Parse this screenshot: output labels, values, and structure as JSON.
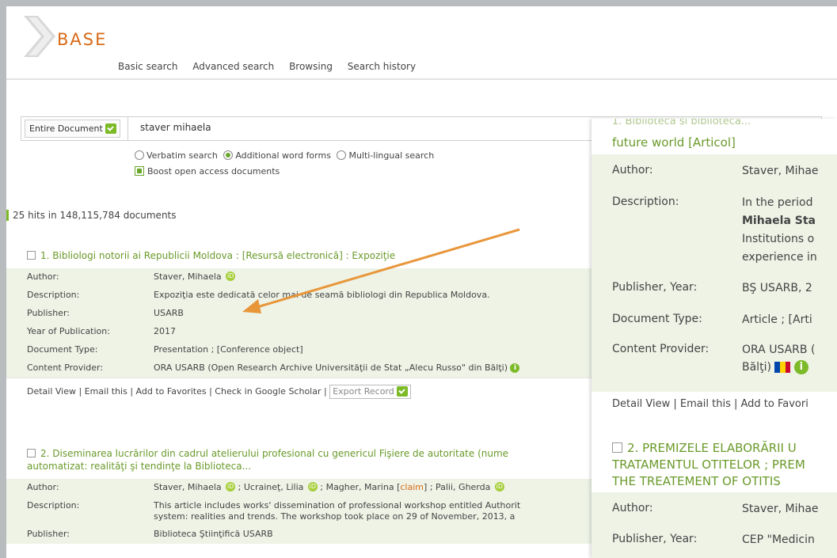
{
  "brand": {
    "logo_text": "BASE",
    "accent": "#d86a18",
    "green": "#7cba28"
  },
  "nav": {
    "items": [
      "Basic search",
      "Advanced search",
      "Browsing",
      "Search history"
    ]
  },
  "search": {
    "scope": "Entire Document",
    "query": "staver mihaela",
    "options": [
      {
        "label": "Verbatim search",
        "selected": false
      },
      {
        "label": "Additional word forms",
        "selected": true
      },
      {
        "label": "Multi-lingual search",
        "selected": false
      }
    ],
    "boost_label": "Boost open access documents",
    "boost_checked": true
  },
  "hits_text": "25 hits in 148,115,784 documents",
  "labels": {
    "author": "Author:",
    "description": "Description:",
    "publisher": "Publisher:",
    "year": "Year of Publication:",
    "doctype": "Document Type:",
    "provider": "Content Provider:"
  },
  "results": [
    {
      "title": "1. Bibliologi notorii ai Republicii Moldova : [Resursă electronică] : Expoziţie",
      "author": "Staver, Mihaela",
      "description": "Expoziţia este dedicată celor mai de seamă bibliologi din Republica Moldova.",
      "publisher": "USARB",
      "year": "2017",
      "doctype": "Presentation ; [Conference object]",
      "provider": "ORA USARB (Open Research Archive Universităţii de Stat „Alecu Russo\" din Bălţi)"
    },
    {
      "title_line1": "2. Diseminarea lucrărilor din cadrul atelierului profesional cu genericul Fişiere de autoritate (nume",
      "title_line2": "automatizat: realităţi şi tendinţe la Biblioteca...",
      "authors": [
        {
          "name": "Staver, Mihaela",
          "orcid": true
        },
        {
          "name": "Ucraineţ, Lilia",
          "orcid": true
        },
        {
          "name": "Magher, Marina",
          "claim": "claim"
        },
        {
          "name": "Palii, Gherda",
          "orcid": true
        }
      ],
      "description_line1": "This article includes works' dissemination of professional workshop entitled Authorit",
      "description_line2": "system: realities and trends. The workshop took place on 29 of November, 2013, a",
      "publisher": "Biblioteca Ştiinţifică USARB"
    }
  ],
  "actions": {
    "detail": "Detail View",
    "email": "Email this",
    "favorites": "Add to Favorites",
    "scholar": "Check in Google Scholar",
    "export": "Export Record",
    "divider": "|"
  },
  "zoom": {
    "cut_title": "1. Biblioteca şi biblioteca... ",
    "title1_line": "future world [Articol]",
    "author_label": "Author:",
    "author": "Staver, Mihae",
    "desc_label": "Description:",
    "desc_lines": [
      "In the period",
      "Mihaela Sta",
      "Institutions o",
      "experience in"
    ],
    "pubyear_label": "Publisher, Year:",
    "pubyear": "BŞ USARB, 2",
    "doctype_label": "Document Type:",
    "doctype": "Article ; [Arti",
    "provider_label": "Content Provider:",
    "provider_line1": "ORA USARB (",
    "provider_line2": "Bălţi)",
    "actions": "Detail View  |  Email this  |  Add to Favori",
    "title2_line1": "2. PREMIZELE ELABORĂRII U",
    "title2_line2": "TRATAMENTUL OTITELOR ; PREM",
    "title2_line3": "THE TREATEMENT OF OTITIS",
    "author2": "Staver, Mihae",
    "pubyear2": "CEP \"Medicin"
  }
}
